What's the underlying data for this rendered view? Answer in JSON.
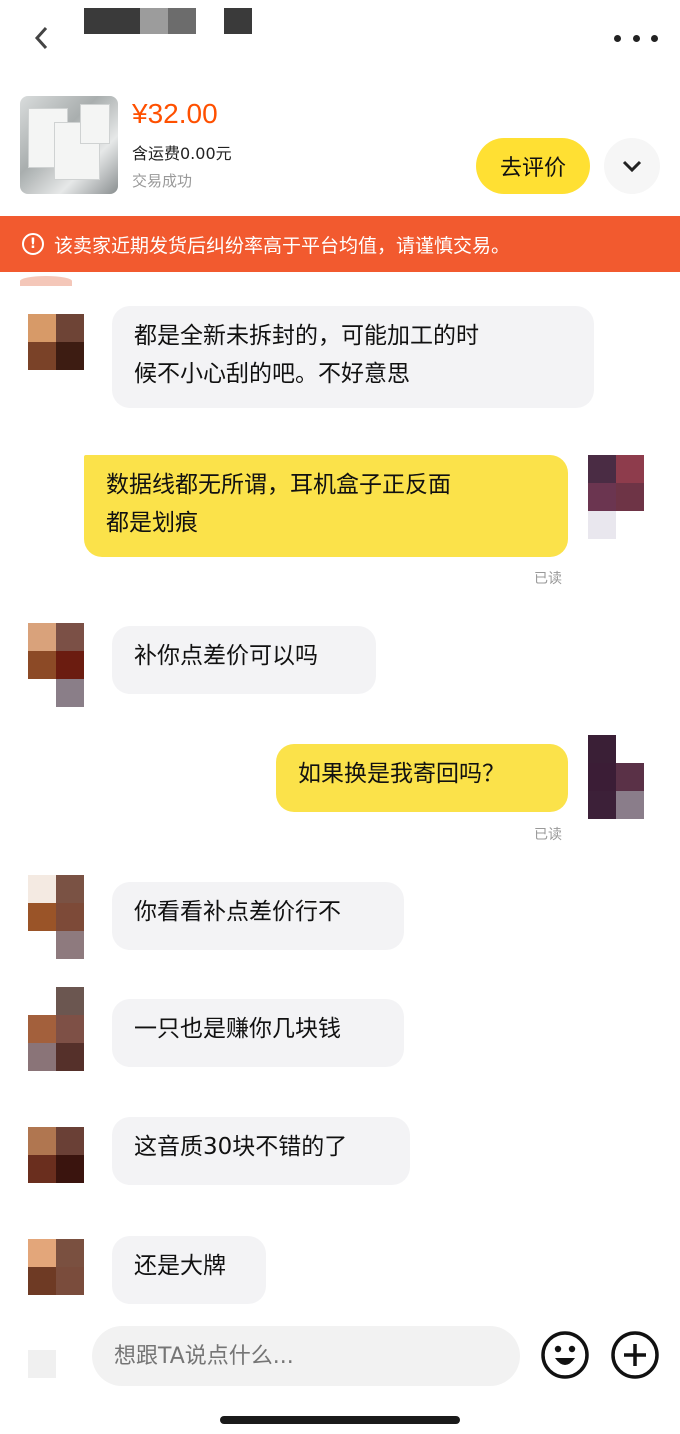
{
  "order": {
    "price": "¥32.00",
    "shipping": "含运费0.00元",
    "status": "交易成功",
    "rate_button": "去评价"
  },
  "warning": {
    "icon_glyph": "!",
    "text": "该卖家近期发货后纠纷率高于平台均值，请谨慎交易。"
  },
  "messages": [
    {
      "side": "in",
      "lines": [
        "都是全新未拆封的，可能加工的时",
        "候不小心刮的吧。不好意思"
      ]
    },
    {
      "side": "out",
      "lines": [
        "数据线都无所谓，耳机盒子正反面",
        "都是划痕"
      ],
      "receipt": "已读"
    },
    {
      "side": "in",
      "lines": [
        "补你点差价可以吗"
      ]
    },
    {
      "side": "out",
      "lines": [
        "如果换是我寄回吗？"
      ],
      "receipt": "已读"
    },
    {
      "side": "in",
      "lines": [
        "你看看补点差价行不"
      ]
    },
    {
      "side": "in",
      "lines": [
        "一只也是赚你几块钱"
      ]
    },
    {
      "side": "in",
      "lines": [
        "这音质30块不错的了"
      ]
    },
    {
      "side": "in",
      "lines": [
        "还是大牌"
      ]
    }
  ],
  "input": {
    "placeholder": "想跟TA说点什么..."
  },
  "colors": {
    "accent_price": "#ff5000",
    "warning_bg": "#f25a2f",
    "outgoing_bubble": "#fbe24a",
    "incoming_bubble": "#f3f3f5",
    "rate_button_bg": "#ffe033"
  },
  "icons": {
    "back": "back-arrow-icon",
    "more": "more-dots-icon",
    "expand": "chevron-down-icon",
    "warning": "warning-circle-icon",
    "emoji": "emoji-icon",
    "plus": "plus-circle-icon"
  }
}
